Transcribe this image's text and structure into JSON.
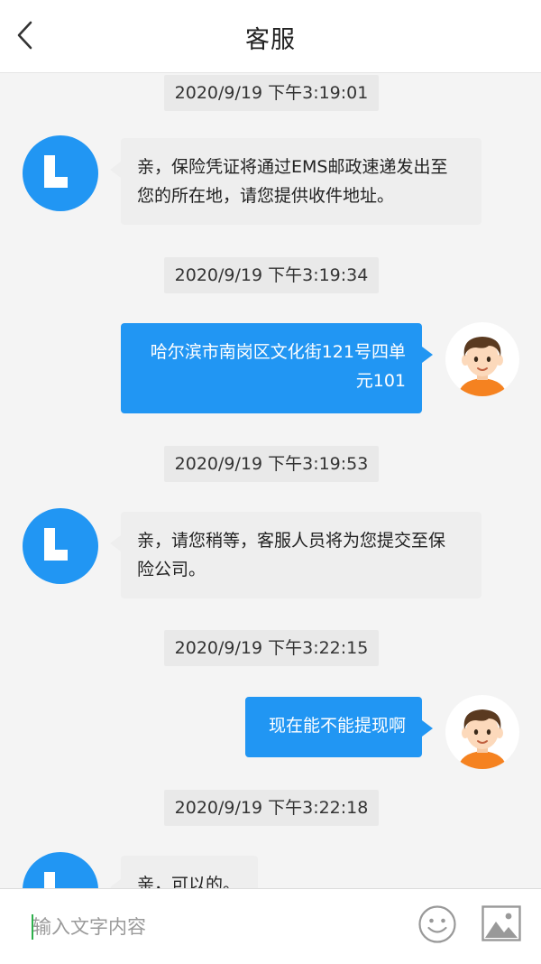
{
  "header": {
    "title": "客服",
    "back_icon": "chevron-left-icon"
  },
  "messages": [
    {
      "time": "2020/9/19 下午3:19:01",
      "side": "agent",
      "lines": [
        "亲，保险凭证将通过EMS邮政速递发出至",
        "您的所在地，请您提供收件地址。"
      ]
    },
    {
      "time": "2020/9/19 下午3:19:34",
      "side": "user",
      "lines": [
        "哈尔滨市南岗区文化街121号四单",
        "元101"
      ]
    },
    {
      "time": "2020/9/19 下午3:19:53",
      "side": "agent",
      "lines": [
        "亲，请您稍等，客服人员将为您提交至保",
        "险公司。"
      ]
    },
    {
      "time": "2020/9/19 下午3:22:15",
      "side": "user",
      "lines": [
        "现在能不能提现啊"
      ]
    },
    {
      "time": "2020/9/19 下午3:22:18",
      "side": "agent",
      "lines": [
        "亲，可以的。"
      ]
    }
  ],
  "input": {
    "placeholder": "输入文字内容",
    "value": ""
  },
  "icons": {
    "emoji": "smiley-face-icon",
    "image": "image-picture-icon",
    "agent_avatar": "service-logo-icon",
    "user_avatar": "user-avatar-icon"
  },
  "colors": {
    "accent": "#2196f3",
    "agent_bubble": "#eeeeee",
    "background": "#f4f4f4",
    "timestamp_bg": "#e9e9e9"
  }
}
